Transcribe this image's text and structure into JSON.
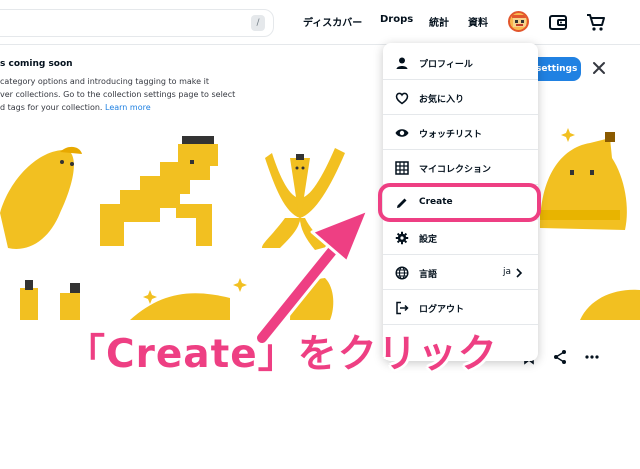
{
  "header": {
    "search_shortcut": "/",
    "nav": [
      "ディスカバー",
      "Drops",
      "統計",
      "資料"
    ]
  },
  "banner": {
    "title": "s coming soon",
    "body_lines": [
      "category options and introducing tagging to make it",
      "ver collections. Go to the collection settings page to select",
      "d tags for your collection."
    ],
    "learn_more": "Learn more",
    "settings_button": "settings"
  },
  "menu": {
    "items": [
      {
        "label": "プロフィール",
        "icon": "person-icon"
      },
      {
        "label": "お気に入り",
        "icon": "heart-icon"
      },
      {
        "label": "ウォッチリスト",
        "icon": "eye-icon"
      },
      {
        "label": "マイコレクション",
        "icon": "grid-icon"
      },
      {
        "label": "Create",
        "icon": "pencil-icon"
      },
      {
        "label": "設定",
        "icon": "gear-icon"
      },
      {
        "label": "言語",
        "icon": "globe-icon",
        "value": "ja"
      },
      {
        "label": "ログアウト",
        "icon": "logout-icon"
      }
    ],
    "highlighted_item": "Create"
  },
  "annotation": {
    "text": "「Create」をクリック",
    "color": "#ee3f83"
  },
  "colors": {
    "accent": "#2081e2",
    "annotation": "#ee3f83",
    "banana": "#f2c021"
  }
}
